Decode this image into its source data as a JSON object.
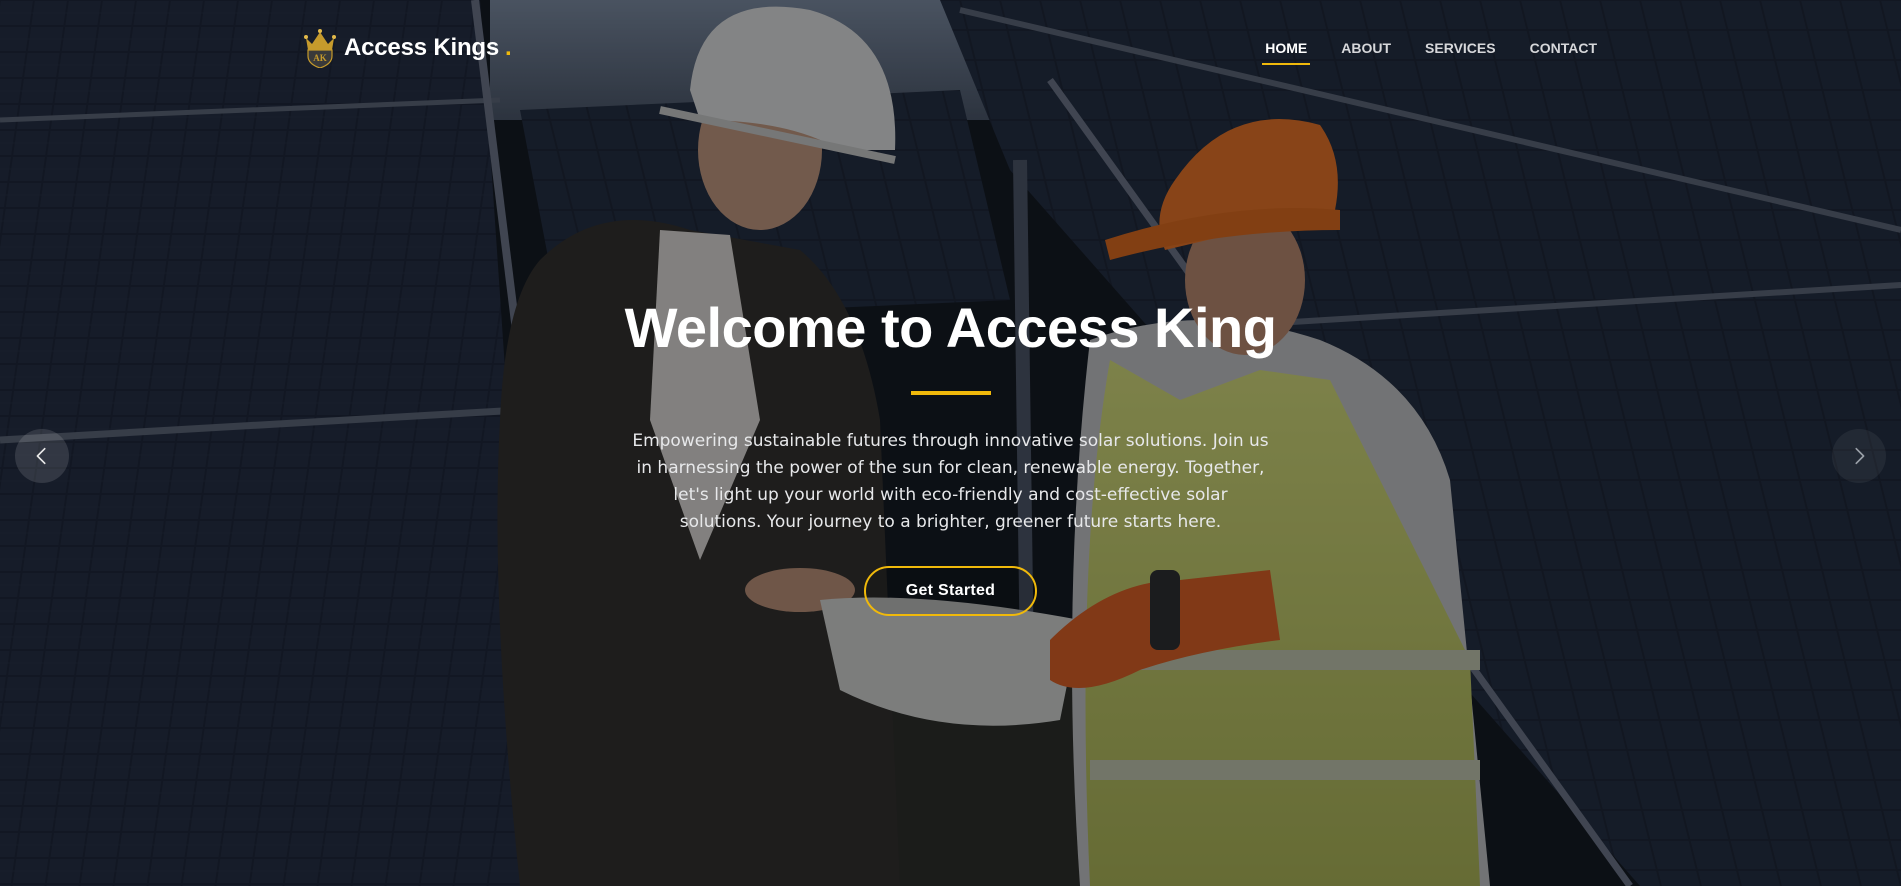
{
  "brand": {
    "name": "Access Kings",
    "dot": ".",
    "accent_color": "#f0b90b",
    "icon": "crown-shield-icon"
  },
  "nav": {
    "items": [
      {
        "label": "HOME",
        "active": true
      },
      {
        "label": "ABOUT",
        "active": false
      },
      {
        "label": "SERVICES",
        "active": false
      },
      {
        "label": "CONTACT",
        "active": false
      }
    ]
  },
  "hero": {
    "title": "Welcome to Access King",
    "description": "Empowering sustainable futures through innovative solar solutions. Join us in harnessing the power of the sun for clean, renewable energy. Together, let's light up your world with eco-friendly and cost-effective solar solutions. Your journey to a brighter, greener future starts here.",
    "cta_label": "Get Started",
    "background_image": "two workers in hard hats reviewing plans among solar panels"
  },
  "carousel": {
    "prev_icon": "chevron-left-icon",
    "next_icon": "chevron-right-icon"
  }
}
